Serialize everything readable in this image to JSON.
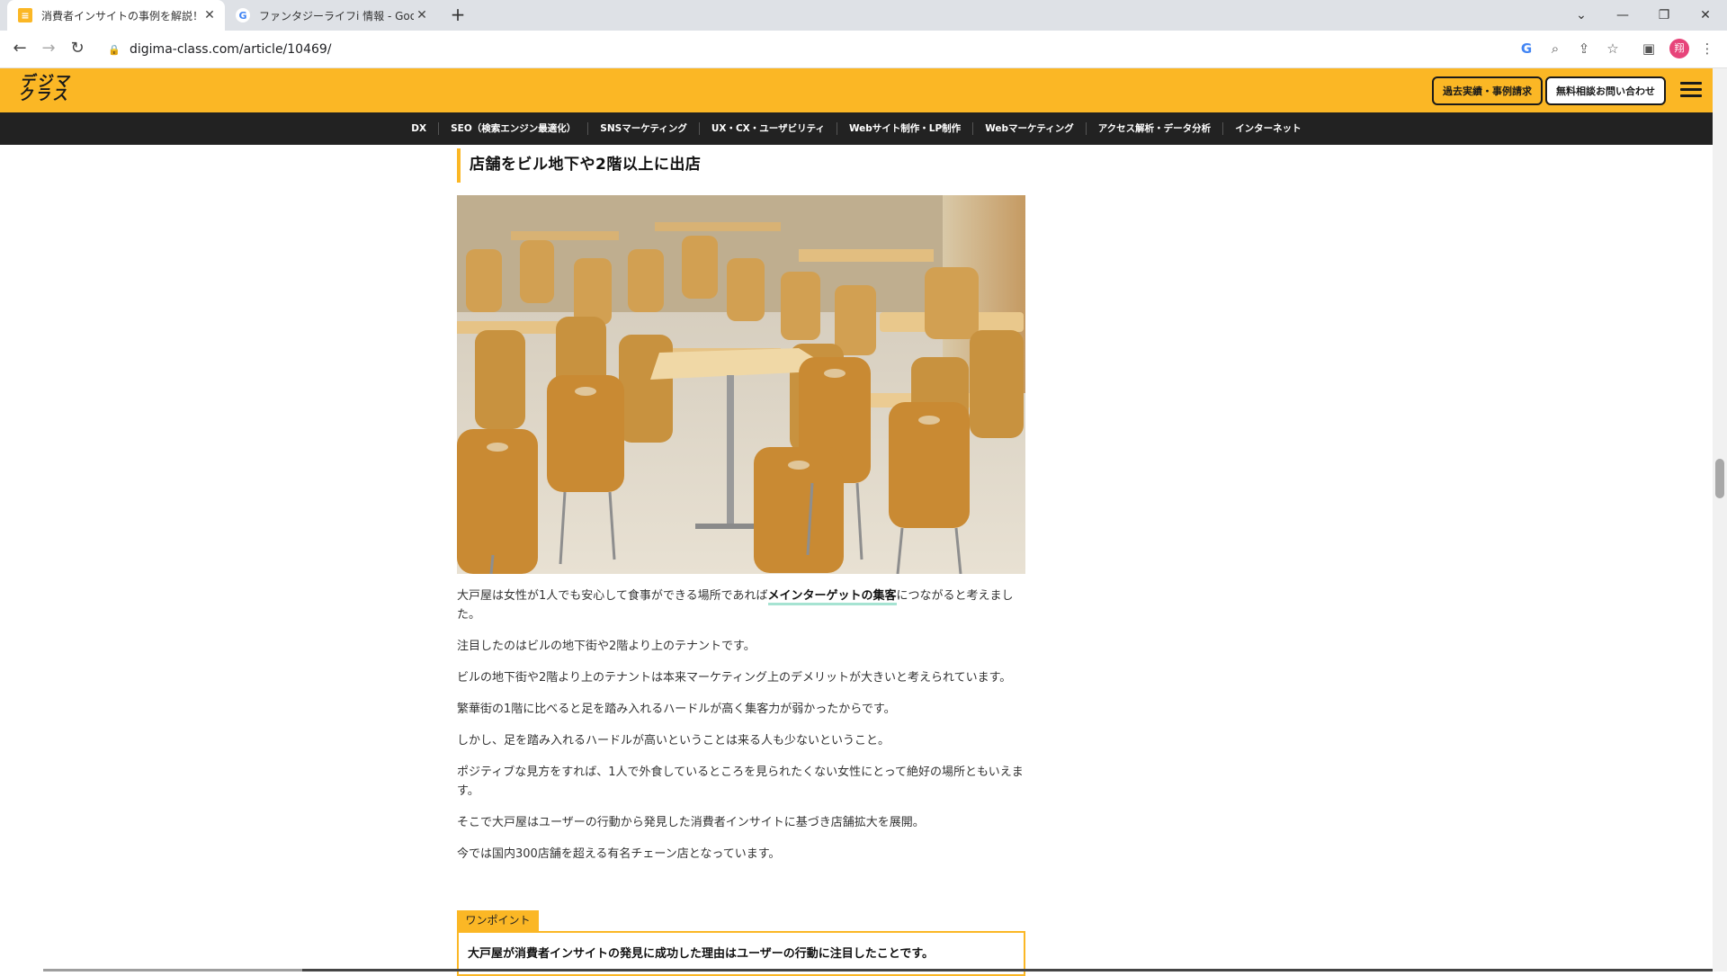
{
  "browser": {
    "tabs": [
      {
        "title": "消費者インサイトの事例を解説！事",
        "active": true,
        "close": "✕"
      },
      {
        "title": "ファンタジーライフi 情報 - Google 検",
        "active": false,
        "close": "✕"
      }
    ],
    "new_tab": "+",
    "url": "digima-class.com/article/10469/",
    "profile_initial": "翔"
  },
  "site": {
    "logo_line1": "デジマ",
    "logo_line2": "クラス",
    "header_buttons": [
      "過去実績・事例請求",
      "無料相談お問い合わせ"
    ],
    "categories": [
      "DX",
      "SEO（検索エンジン最適化）",
      "SNSマーケティング",
      "UX・CX・ユーザビリティ",
      "Webサイト制作・LP制作",
      "Webマーケティング",
      "アクセス解析・データ分析",
      "インターネット"
    ]
  },
  "article": {
    "heading": "店舗をビル地下や2階以上に出店",
    "para1_before": "大戸屋は女性が1人でも安心して食事ができる場所であれば",
    "para1_link": "メインターゲットの集客",
    "para1_after": "につながると考えました。",
    "paragraphs": [
      "注目したのはビルの地下街や2階より上のテナントです。",
      "ビルの地下街や2階より上のテナントは本来マーケティング上のデメリットが大きいと考えられています。",
      "繁華街の1階に比べると足を踏み入れるハードルが高く集客力が弱かったからです。",
      "しかし、足を踏み入れるハードルが高いということは来る人も少ないということ。",
      "ポジティブな見方をすれば、1人で外食しているところを見られたくない女性にとって絶好の場所ともいえます。",
      "そこで大戸屋はユーザーの行動から発見した消費者インサイトに基づき店舗拡大を展開。",
      "今では国内300店舗を超える有名チェーン店となっています。"
    ],
    "onepoint_label": "ワンポイント",
    "onepoint_text": "大戸屋が消費者インサイトの発見に成功した理由はユーザーの行動に注目したことです。"
  },
  "colors": {
    "brand_yellow": "#fbb725",
    "nav_dark": "#222222",
    "link_underline": "#a6e3d2"
  }
}
